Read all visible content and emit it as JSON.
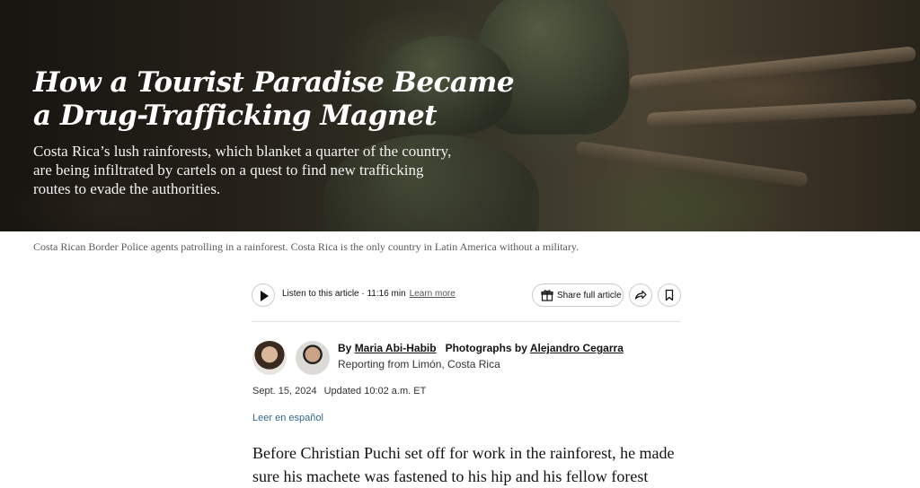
{
  "hero": {
    "title": "How a Tourist Paradise Became a Drug-Trafficking Magnet",
    "summary": "Costa Rica’s lush rainforests, which blanket a quarter of the country, are being infiltrated by cartels on a quest to find new trafficking routes to evade the authorities.",
    "caption": "Costa Rican Border Police agents patrolling in a rainforest. Costa Rica is the only country in Latin America without a military."
  },
  "toolbar": {
    "listen_label": "Listen to this article · 11:16 min",
    "learn_more": "Learn more",
    "share_label": "Share full article"
  },
  "byline": {
    "by": "By",
    "author": "Maria Abi-Habib",
    "photos_prefix": "Photographs by",
    "photographer": "Alejandro Cegarra",
    "reporting": "Reporting from Limón, Costa Rica"
  },
  "meta": {
    "date": "Sept. 15, 2024",
    "updated": "Updated 10:02 a.m. ET",
    "spanish_link": "Leer en español"
  },
  "article": {
    "first_paragraph": "Before Christian Puchi set off for work in the rainforest, he made sure his machete was fastened to his hip and his fellow forest"
  },
  "colors": {
    "link_blue": "#326891",
    "text": "#121212"
  }
}
